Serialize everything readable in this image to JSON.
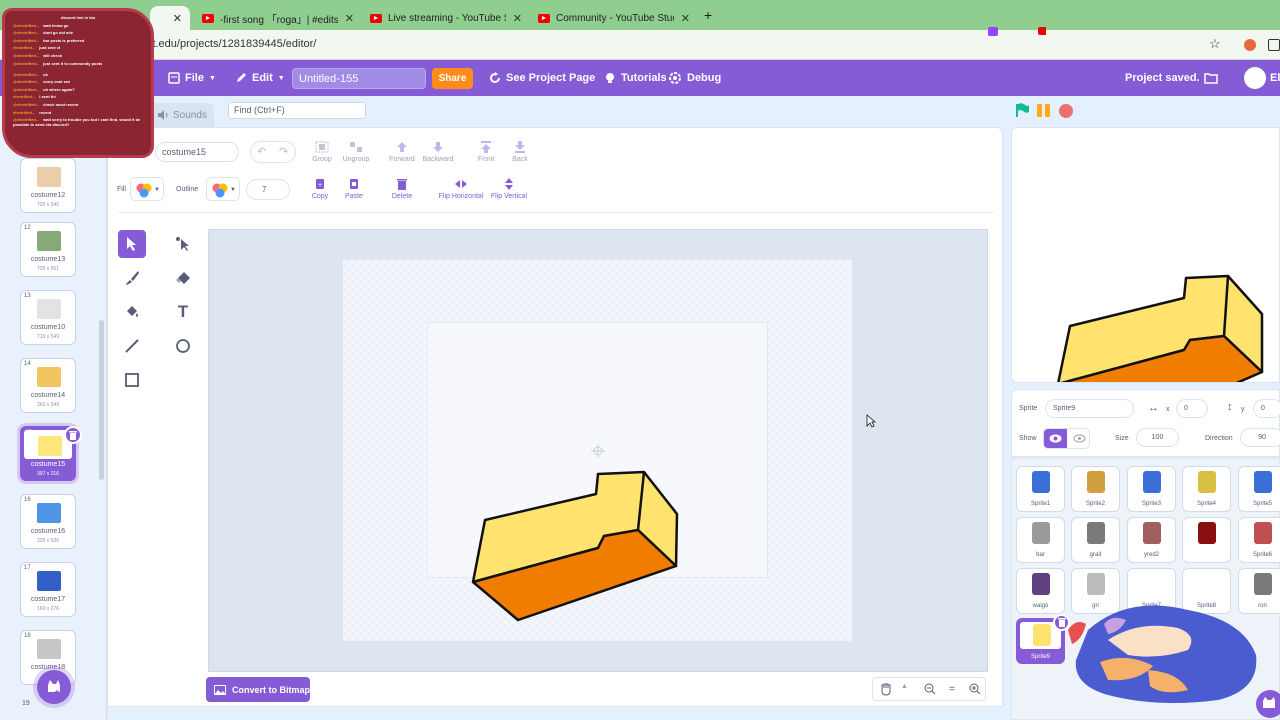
{
  "browser": {
    "tabs": [
      {
        "label": "",
        "active": true
      },
      {
        "label": "-first song 「roga」| #edits #edit"
      },
      {
        "label": "Live streaming - YouTube Studio"
      },
      {
        "label": "Community - YouTube Studio"
      }
    ],
    "url": "it.edu/projects/1281839445/editor/"
  },
  "menubar": {
    "file": "File",
    "edit": "Edit",
    "title": "Untitled-155",
    "share": "Share",
    "see_project": "See Project Page",
    "tutorials": "Tutorials",
    "debug": "Debug",
    "saved": "Project saved.",
    "user_initial": "El"
  },
  "editor_tabs": {
    "sounds": "Sounds",
    "find_placeholder": "Find (Ctrl+F)"
  },
  "paint": {
    "costume_label": "ostume",
    "costume_name": "costume15",
    "toolbar": [
      "Group",
      "Ungroup",
      "Forward",
      "Backward",
      "Front",
      "Back"
    ],
    "fill_label": "Fill",
    "outline_label": "Outline",
    "outline_width": "7",
    "actions": [
      "Copy",
      "Paste",
      "Delete",
      "Flip Horizontal",
      "Flip Vertical"
    ],
    "convert": "Convert to Bitmap",
    "zoom": {
      "out": "−",
      "reset": "=",
      "in": "+"
    }
  },
  "costumes": [
    {
      "num": "",
      "name": "costume12",
      "dim": "720 x 540",
      "color": "#e8c8a0"
    },
    {
      "num": "12",
      "name": "costume13",
      "dim": "735 x 551",
      "color": "#7a9f6a"
    },
    {
      "num": "13",
      "name": "costume10",
      "dim": "719 x 549",
      "color": "#e0e0e0"
    },
    {
      "num": "14",
      "name": "costume14",
      "dim": "360 x 549",
      "color": "#f0c050"
    },
    {
      "num": "15",
      "name": "costume15",
      "dim": "397 x 216",
      "color": "#ffe36e",
      "selected": true
    },
    {
      "num": "16",
      "name": "costume16",
      "dim": "335 x 536",
      "color": "#3b8be0"
    },
    {
      "num": "17",
      "name": "costume17",
      "dim": "160 x 276",
      "color": "#1d4fc0"
    },
    {
      "num": "18",
      "name": "costume18",
      "dim": "",
      "color": "#c0c0c0"
    }
  ],
  "costume_19_num": "19",
  "sprite_info": {
    "sprite_label": "Sprite",
    "sprite_name": "Sprite9",
    "x_label": "x",
    "x": "0",
    "y_label": "y",
    "y": "0",
    "show_label": "Show",
    "size_label": "Size",
    "size": "100",
    "direction_label": "Direction",
    "direction": "90"
  },
  "sprites": [
    {
      "name": "Sprite1",
      "color": "#3b6fd8"
    },
    {
      "name": "Sprite2",
      "color": "#d0a040"
    },
    {
      "name": "Sprite3",
      "color": "#3b6fd8"
    },
    {
      "name": "Sprite4",
      "color": "#d8c040"
    },
    {
      "name": "Sprite5",
      "color": "#3b6fd8"
    },
    {
      "name": "bar",
      "color": "#9a9a9a"
    },
    {
      "name": "grait",
      "color": "#7a7a7a"
    },
    {
      "name": "yred2",
      "color": "#a06060"
    },
    {
      "name": "",
      "color": "#8a1010"
    },
    {
      "name": "Sprite6",
      "color": "#c05050"
    },
    {
      "name": "waigo",
      "color": "#604080"
    },
    {
      "name": "gri",
      "color": "#bbbbbb"
    },
    {
      "name": "Sprite7",
      "color": "#ffffff"
    },
    {
      "name": "Sprite8",
      "color": "#ffffff"
    },
    {
      "name": "ron",
      "color": "#7a7a7a"
    },
    {
      "name": "Sprite9",
      "color": "#ffe36e",
      "selected": true
    }
  ],
  "chat": [
    {
      "user": "",
      "msg": "discord link in bio"
    },
    {
      "user": "@electrified...",
      "msg": "wait imma go"
    },
    {
      "user": "@electrified...",
      "msg": "dont go old mie"
    },
    {
      "user": "@electrified...",
      "msg": "bar posts is preferred"
    },
    {
      "user": "electrified...",
      "msg": "just sent vt"
    },
    {
      "user": "@electrified...",
      "msg": "will check"
    },
    {
      "user": "@electrified...",
      "msg": "just sent it to community posts"
    },
    {
      "user": "@electrified...",
      "msg": "ok"
    },
    {
      "user": "@electrified...",
      "msg": "sorry cant see"
    },
    {
      "user": "@electrified...",
      "msg": "uh where again?"
    },
    {
      "user": "electrified...",
      "msg": "I sent thi"
    },
    {
      "user": "@electrified...",
      "msg": "check most recent"
    },
    {
      "user": "electrified...",
      "msg": "recent"
    },
    {
      "user": "@electrified...",
      "msg": "wait sorry to trouble you but i cant find, would it be possible to send via discord?"
    }
  ],
  "colors": {
    "accent": "#855cd6",
    "share": "#ff8c1a",
    "flag": "#0fbd8c",
    "pause": "#ffab19",
    "stop": "#ec5959",
    "shape_top": "#ffe36e",
    "shape_side": "#f07c00"
  }
}
